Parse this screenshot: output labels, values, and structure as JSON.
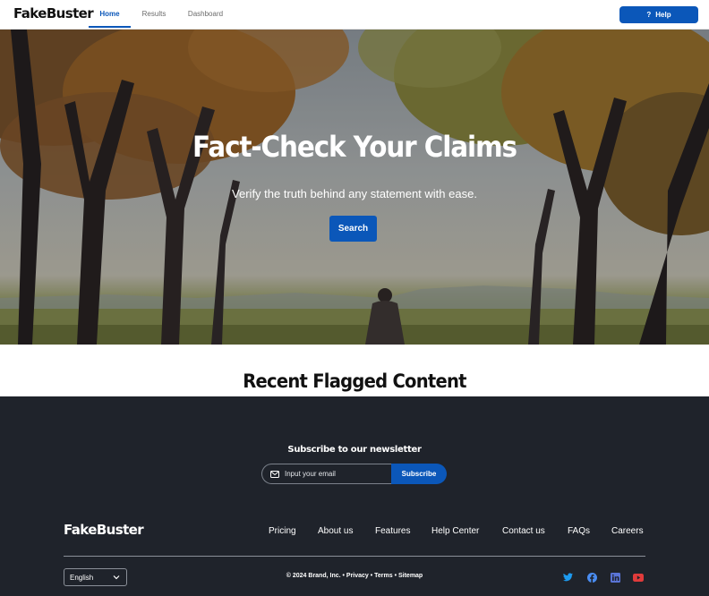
{
  "navbar": {
    "brand": "FakeBuster",
    "tabs": [
      {
        "label": "Home",
        "active": true
      },
      {
        "label": "Results",
        "active": false
      },
      {
        "label": "Dashboard",
        "active": false
      }
    ],
    "help_icon": "?",
    "help_label": "Help"
  },
  "hero": {
    "title": "Fact-Check Your Claims",
    "subtitle": "Verify the truth behind any statement with ease.",
    "search_label": "Search"
  },
  "recent": {
    "title": "Recent Flagged Content"
  },
  "footer": {
    "newsletter": {
      "title": "Subscribe to our newsletter",
      "placeholder": "Input your email",
      "button_label": "Subscribe"
    },
    "brand": "FakeBuster",
    "links": [
      "Pricing",
      "About us",
      "Features",
      "Help Center",
      "Contact us",
      "FAQs",
      "Careers"
    ],
    "language": "English",
    "copyright": "© 2024 Brand, Inc. • Privacy • Terms • Sitemap",
    "social": [
      "twitter-icon",
      "facebook-icon",
      "linkedin-icon",
      "youtube-icon"
    ]
  },
  "colors": {
    "primary": "#0b57b9",
    "footer_bg": "#1f232b",
    "twitter": "#1d9bf0",
    "facebook": "#4a8df2",
    "linkedin": "#5a74d6",
    "youtube": "#e03b3b"
  }
}
